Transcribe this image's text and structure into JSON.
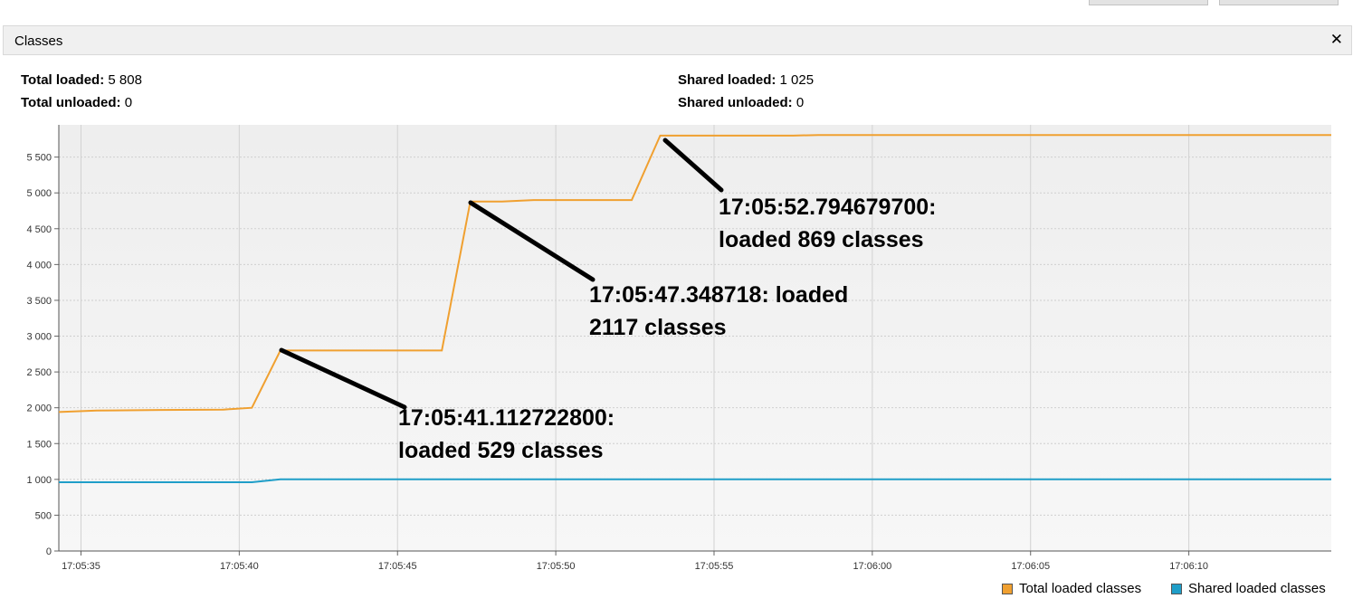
{
  "panel": {
    "title": "Classes",
    "close_glyph": "✕"
  },
  "stats": {
    "total_loaded_label": "Total loaded:",
    "total_loaded": "5 808",
    "total_unloaded_label": "Total unloaded:",
    "total_unloaded": "0",
    "shared_loaded_label": "Shared loaded:",
    "shared_loaded": "1 025",
    "shared_unloaded_label": "Shared unloaded:",
    "shared_unloaded": "0"
  },
  "legend": {
    "total_label": "Total loaded classes",
    "shared_label": "Shared loaded classes"
  },
  "colors": {
    "total": "#f0a030",
    "shared": "#1f9ec8",
    "plot_bg": "#f4f4f4",
    "grid": "#d8d8d8"
  },
  "chart_data": {
    "type": "line",
    "xlim": [
      "17:05:34.300",
      "17:06:14.500"
    ],
    "ylim": [
      0,
      5950
    ],
    "yticks": [
      0,
      500,
      1000,
      1500,
      2000,
      2500,
      3000,
      3500,
      4000,
      4500,
      5000,
      5500
    ],
    "ytick_labels": [
      "0",
      "500",
      "1 000",
      "1 500",
      "2 000",
      "2 500",
      "3 000",
      "3 500",
      "4 000",
      "4 500",
      "5 000",
      "5 500"
    ],
    "xticks": [
      "17:05:35",
      "17:05:40",
      "17:05:45",
      "17:05:50",
      "17:05:55",
      "17:06:00",
      "17:06:05",
      "17:06:10"
    ],
    "series": [
      {
        "name": "Total loaded classes",
        "points": [
          [
            "17:05:34.300",
            1940
          ],
          [
            "17:05:35.500",
            1960
          ],
          [
            "17:05:37.500",
            1970
          ],
          [
            "17:05:39.500",
            1975
          ],
          [
            "17:05:40.400",
            2000
          ],
          [
            "17:05:41.300",
            2800
          ],
          [
            "17:05:46.400",
            2800
          ],
          [
            "17:05:47.300",
            4880
          ],
          [
            "17:05:48.300",
            4880
          ],
          [
            "17:05:49.300",
            4900
          ],
          [
            "17:05:52.400",
            4900
          ],
          [
            "17:05:53.300",
            5800
          ],
          [
            "17:05:57.500",
            5800
          ],
          [
            "17:05:58.300",
            5808
          ],
          [
            "17:06:14.500",
            5808
          ]
        ]
      },
      {
        "name": "Shared loaded classes",
        "points": [
          [
            "17:05:34.300",
            960
          ],
          [
            "17:05:40.400",
            960
          ],
          [
            "17:05:41.300",
            1000
          ],
          [
            "17:06:14.500",
            1000
          ]
        ]
      }
    ],
    "annotations": [
      {
        "line1": "17:05:41.112722800:",
        "line2": "loaded 529 classes"
      },
      {
        "line1": "17:05:47.348718: loaded",
        "line2": "2117 classes"
      },
      {
        "line1": "17:05:52.794679700:",
        "line2": "loaded 869 classes"
      }
    ]
  }
}
